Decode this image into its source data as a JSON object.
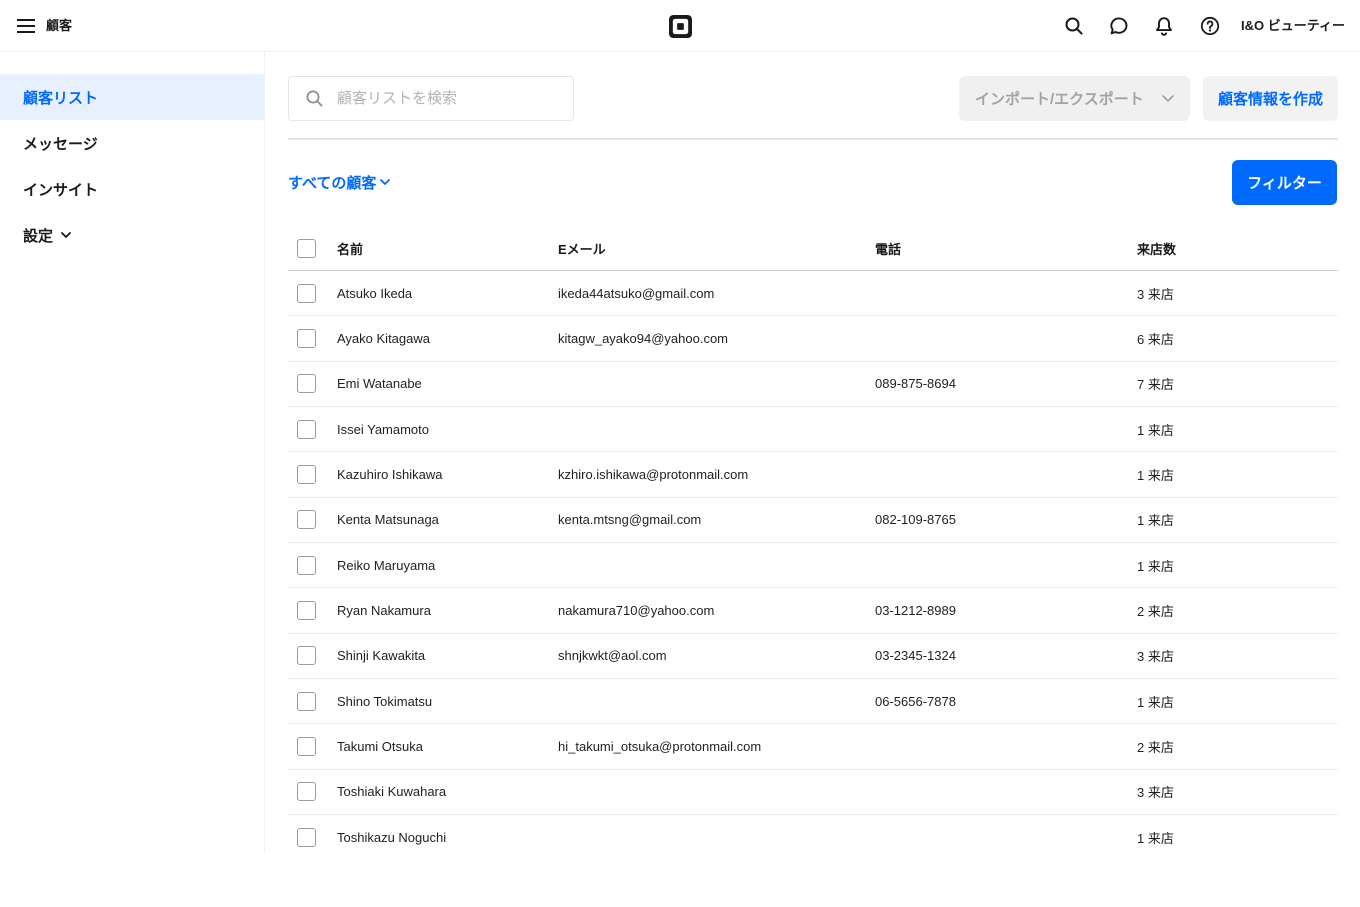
{
  "topbar": {
    "menu_icon": "menu-icon",
    "title": "顧客",
    "logo": "square-logo",
    "search_icon": "search-icon",
    "messages_icon": "chat-bubble-icon",
    "notifications_icon": "bell-icon",
    "help_icon": "help-icon",
    "account_name": "I&O ビューティー"
  },
  "sidebar": {
    "items": [
      {
        "label": "顧客リスト",
        "active": true
      },
      {
        "label": "メッセージ",
        "active": false
      },
      {
        "label": "インサイト",
        "active": false
      },
      {
        "label": "設定",
        "active": false,
        "icon": "chevron-down-icon"
      }
    ]
  },
  "toolbar": {
    "search_icon": "search-icon",
    "search_placeholder": "顧客リストを検索",
    "import_export_label": "インポート/エクスポート",
    "import_export_icon": "chevron-down-icon",
    "create_label": "顧客情報を作成"
  },
  "list_controls": {
    "segment_label": "すべての顧客",
    "segment_icon": "chevron-down-icon",
    "filter_label": "フィルター"
  },
  "table": {
    "columns": {
      "name": "名前",
      "email": "Eメール",
      "phone": "電話",
      "visits": "来店数"
    },
    "rows": [
      {
        "name": "Atsuko Ikeda",
        "email": "ikeda44atsuko@gmail.com",
        "phone": "",
        "visits": "3 来店"
      },
      {
        "name": "Ayako Kitagawa",
        "email": "kitagw_ayako94@yahoo.com",
        "phone": "",
        "visits": "6 来店"
      },
      {
        "name": "Emi Watanabe",
        "email": "",
        "phone": "089-875-8694",
        "visits": "7 来店"
      },
      {
        "name": "Issei Yamamoto",
        "email": "",
        "phone": "",
        "visits": "1 来店"
      },
      {
        "name": "Kazuhiro Ishikawa",
        "email": "kzhiro.ishikawa@protonmail.com",
        "phone": "",
        "visits": "1 来店"
      },
      {
        "name": "Kenta Matsunaga",
        "email": "kenta.mtsng@gmail.com",
        "phone": "082-109-8765",
        "visits": "1 来店"
      },
      {
        "name": "Reiko Maruyama",
        "email": "",
        "phone": "",
        "visits": "1 来店"
      },
      {
        "name": "Ryan Nakamura",
        "email": "nakamura710@yahoo.com",
        "phone": "03-1212-8989",
        "visits": "2 来店"
      },
      {
        "name": "Shinji Kawakita",
        "email": "shnjkwkt@aol.com",
        "phone": "03-2345-1324",
        "visits": "3 来店"
      },
      {
        "name": "Shino Tokimatsu",
        "email": "",
        "phone": "06-5656-7878",
        "visits": "1 来店"
      },
      {
        "name": "Takumi Otsuka",
        "email": "hi_takumi_otsuka@protonmail.com",
        "phone": "",
        "visits": "2 来店"
      },
      {
        "name": "Toshiaki Kuwahara",
        "email": "",
        "phone": "",
        "visits": "3 来店"
      },
      {
        "name": "Toshikazu Noguchi",
        "email": "",
        "phone": "",
        "visits": "1 来店"
      }
    ]
  },
  "colors": {
    "accent": "#006aff",
    "active_bg": "#e6f0ff",
    "text": "#1a1a1a",
    "muted": "#a3a3a3"
  }
}
